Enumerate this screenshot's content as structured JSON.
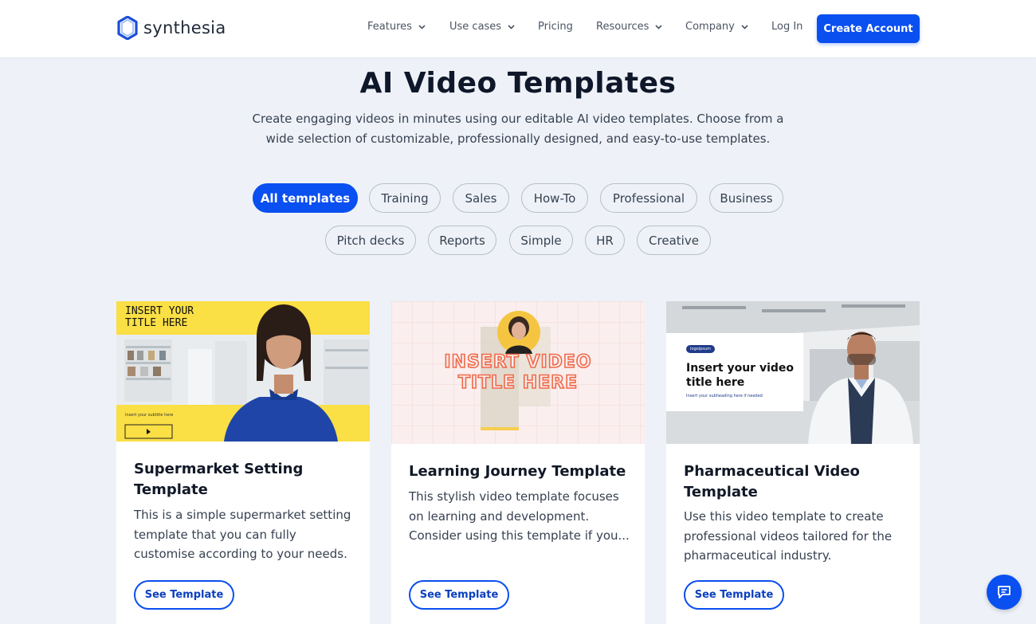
{
  "header": {
    "logo_text": "synthesia",
    "nav": [
      {
        "label": "Features",
        "has_dropdown": true
      },
      {
        "label": "Use cases",
        "has_dropdown": true
      },
      {
        "label": "Pricing",
        "has_dropdown": false
      },
      {
        "label": "Resources",
        "has_dropdown": true
      },
      {
        "label": "Company",
        "has_dropdown": true
      },
      {
        "label": "Log In",
        "has_dropdown": false
      }
    ],
    "cta_label": "Create Account"
  },
  "hero": {
    "title": "AI Video Templates",
    "subtitle_line1": "Create engaging videos in minutes using our editable AI video templates. Choose from a",
    "subtitle_line2": "wide selection of customizable, professionally designed, and easy-to-use templates."
  },
  "filters": [
    {
      "label": "All templates",
      "active": true
    },
    {
      "label": "Training",
      "active": false
    },
    {
      "label": "Sales",
      "active": false
    },
    {
      "label": "How-To",
      "active": false
    },
    {
      "label": "Professional",
      "active": false
    },
    {
      "label": "Business",
      "active": false
    },
    {
      "label": "Pitch decks",
      "active": false
    },
    {
      "label": "Reports",
      "active": false
    },
    {
      "label": "Simple",
      "active": false
    },
    {
      "label": "HR",
      "active": false
    },
    {
      "label": "Creative",
      "active": false
    }
  ],
  "cards": [
    {
      "title_line1": "Supermarket Setting",
      "title_line2": "Template",
      "desc_line1": "This is a simple supermarket setting",
      "desc_line2": "template that you can fully",
      "desc_line3": "customise according to your needs.",
      "button": "See Template",
      "thumb": {
        "heading_line1": "INSERT YOUR",
        "heading_line2": "TITLE HERE",
        "subtitle": "Insert your subtitle here"
      }
    },
    {
      "title_line1": "Learning Journey Template",
      "title_line2": "",
      "desc_line1": "This stylish video template focuses",
      "desc_line2": "on learning and development.",
      "desc_line3": "Consider using this template if you...",
      "button": "See Template",
      "thumb": {
        "heading_line1": "INSERT VIDEO",
        "heading_line2": "TITLE HERE"
      }
    },
    {
      "title_line1": "Pharmaceutical Video",
      "title_line2": "Template",
      "desc_line1": "Use this video template to create",
      "desc_line2": "professional videos tailored for the",
      "desc_line3": "pharmaceutical industry.",
      "button": "See Template",
      "thumb": {
        "badge": "logoipsum",
        "heading_line1": "Insert your video",
        "heading_line2": "title here",
        "subheading": "Insert your subheading here if needed"
      }
    }
  ],
  "colors": {
    "brand_blue": "#0a4ff0",
    "page_bg": "#eef2f8",
    "thumb_yellow": "#fadf45",
    "thumb_orange": "#f06a4a"
  },
  "chat_icon": "chat-bubble-icon"
}
